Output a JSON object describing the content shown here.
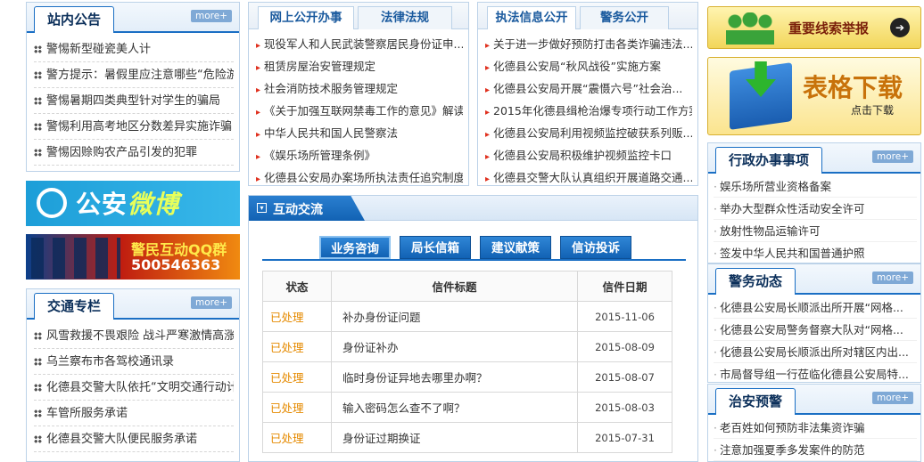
{
  "notice": {
    "title": "站内公告",
    "more": "more+",
    "items": [
      "警惕新型碰瓷美人计",
      "警方提示：暑假里应注意哪些“危险游",
      "警惕暑期四类典型针对学生的骗局",
      "警惕利用高考地区分数差异实施诈骗",
      "警惕因赊购农产品引发的犯罪"
    ]
  },
  "weibo": {
    "text1": "公安",
    "text2": "微博"
  },
  "qq": {
    "title": "警民互动QQ群",
    "number": "500546363"
  },
  "traffic": {
    "title": "交通专栏",
    "more": "more+",
    "items": [
      "风雪救援不畏艰险 战斗严寒激情高涨",
      "乌兰察布市各驾校通讯录",
      "化德县交警大队依托“文明交通行动计",
      "车管所服务承诺",
      "化德县交警大队便民服务承诺"
    ]
  },
  "pub": {
    "tabs": [
      "网上公开办事",
      "法律法规"
    ],
    "items": [
      "现役军人和人民武装警察居民身份证申...",
      "租赁房屋治安管理规定",
      "社会消防技术服务管理规定",
      "《关于加强互联网禁毒工作的意见》解读",
      "中华人民共和国人民警察法",
      "《娱乐场所管理条例》",
      "化德县公安局办案场所执法责任追究制度"
    ]
  },
  "law": {
    "tabs": [
      "执法信息公开",
      "警务公开"
    ],
    "items": [
      "关于进一步做好预防打击各类诈骗违法...",
      "化德县公安局“秋风战役”实施方案",
      "化德县公安局开展“震慑六号”社会治...",
      "2015年化德县缉枪治爆专项行动工作方案",
      "化德县公安局利用视频监控破获系列贩...",
      "化德县公安局积极维护视频监控卡口",
      "化德县交警大队认真组织开展道路交通..."
    ]
  },
  "interact": {
    "title": "互动交流",
    "buttons": [
      "业务咨询",
      "局长信箱",
      "建议献策",
      "信访投诉"
    ],
    "headers": [
      "状态",
      "信件标题",
      "信件日期"
    ],
    "rows": [
      [
        "已处理",
        "补办身份证问题",
        "2015-11-06"
      ],
      [
        "已处理",
        "身份证补办",
        "2015-08-09"
      ],
      [
        "已处理",
        "临时身份证异地去哪里办啊？",
        "2015-08-07"
      ],
      [
        "已处理",
        "输入密码怎么查不了啊？",
        "2015-08-03"
      ],
      [
        "已处理",
        "身份证过期换证",
        "2015-07-31"
      ]
    ]
  },
  "report": {
    "label": "重要线索举报",
    "arrow": "➔"
  },
  "download": {
    "title": "表格下载",
    "sub": "点击下载"
  },
  "admin": {
    "title": "行政办事事项",
    "more": "more+",
    "items": [
      "娱乐场所营业资格备案",
      "举办大型群众性活动安全许可",
      "放射性物品运输许可",
      "签发中华人民共和国普通护照"
    ]
  },
  "news": {
    "title": "警务动态",
    "more": "more+",
    "items": [
      "化德县公安局长顺派出所开展“网格...",
      "化德县公安局警务督察大队对“网格...",
      "化德县公安局长顺派出所对辖区内出...",
      "市局督导组一行莅临化德县公安局特..."
    ]
  },
  "warn": {
    "title": "治安预警",
    "more": "more+",
    "items": [
      "老百姓如何预防非法集资诈骗",
      "注意加强夏季多发案件的防范"
    ]
  },
  "colors": {
    "accent": "#1a6fc4",
    "orange": "#e07a00",
    "status": "#e58a00",
    "red": "#e0301e"
  }
}
